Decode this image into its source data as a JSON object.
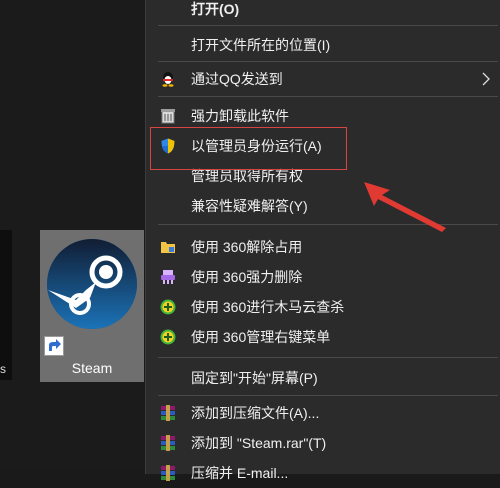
{
  "desktop": {
    "icon_label": "Steam"
  },
  "context_menu": {
    "items": [
      {
        "label": "打开(O)",
        "icon": "none"
      },
      {
        "label": "打开文件所在的位置(I)",
        "icon": "none"
      },
      {
        "label": "通过QQ发送到",
        "icon": "qq-penguin-icon",
        "submenu": true
      },
      {
        "label": "强力卸载此软件",
        "icon": "uninstall-icon"
      },
      {
        "label": "以管理员身份运行(A)",
        "icon": "uac-shield-icon"
      },
      {
        "label": "管理员取得所有权",
        "icon": "none"
      },
      {
        "label": "兼容性疑难解答(Y)",
        "icon": "none"
      },
      {
        "label": "使用 360解除占用",
        "icon": "folder-unlock-icon"
      },
      {
        "label": "使用 360强力删除",
        "icon": "shredder-icon"
      },
      {
        "label": "使用 360进行木马云查杀",
        "icon": "360-plus-icon"
      },
      {
        "label": "使用 360管理右键菜单",
        "icon": "360-plus-icon"
      },
      {
        "label": "固定到\"开始\"屏幕(P)",
        "icon": "none"
      },
      {
        "label": "添加到压缩文件(A)...",
        "icon": "winrar-icon"
      },
      {
        "label": "添加到 \"Steam.rar\"(T)",
        "icon": "winrar-icon"
      },
      {
        "label": "压缩并 E-mail...",
        "icon": "winrar-icon"
      }
    ]
  },
  "annotation": {
    "highlight_color": "#d64541"
  }
}
